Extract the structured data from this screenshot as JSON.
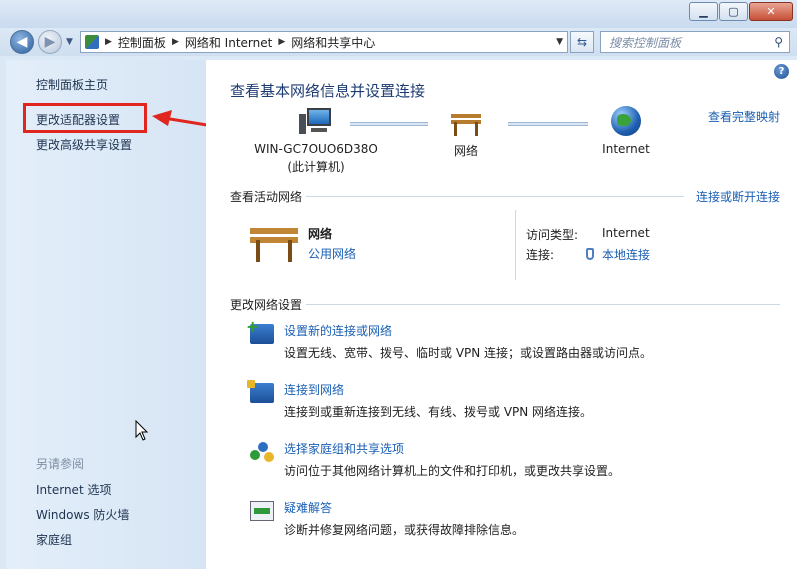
{
  "window": {
    "minimize_glyph": "▁",
    "maximize_glyph": "▢",
    "close_glyph": "✕"
  },
  "nav": {
    "back_glyph": "◀",
    "forward_glyph": "▶",
    "breadcrumb": [
      "控制面板",
      "网络和 Internet",
      "网络和共享中心"
    ],
    "breadcrumb_separator": "▶",
    "search_placeholder": "搜索控制面板",
    "search_icon": "magnifier-icon",
    "refresh_icon": "refresh-icon"
  },
  "sidebar": {
    "items": [
      {
        "label": "控制面板主页"
      },
      {
        "label": "更改适配器设置"
      },
      {
        "label": "更改高级共享设置"
      }
    ],
    "see_also_label": "另请参阅",
    "see_also": [
      {
        "label": "Internet 选项"
      },
      {
        "label": "Windows 防火墙"
      },
      {
        "label": "家庭组"
      }
    ]
  },
  "main": {
    "help_glyph": "?",
    "title": "查看基本网络信息并设置连接",
    "full_map_link": "查看完整映射",
    "map": {
      "computer_name": "WIN-GC7OUO6D38O",
      "computer_note": "(此计算机)",
      "network_label": "网络",
      "internet_label": "Internet"
    },
    "active": {
      "section_label": "查看活动网络",
      "connect_disconnect_link": "连接或断开连接",
      "network_name": "网络",
      "network_type": "公用网络",
      "access_type_key": "访问类型:",
      "access_type_value": "Internet",
      "connection_key": "连接:",
      "connection_value": "本地连接"
    },
    "change": {
      "section_label": "更改网络设置",
      "tasks": [
        {
          "title": "设置新的连接或网络",
          "desc": "设置无线、宽带、拨号、临时或 VPN 连接；或设置路由器或访问点。",
          "icon": "new-connection-icon"
        },
        {
          "title": "连接到网络",
          "desc": "连接到或重新连接到无线、有线、拨号或 VPN 网络连接。",
          "icon": "connect-network-icon"
        },
        {
          "title": "选择家庭组和共享选项",
          "desc": "访问位于其他网络计算机上的文件和打印机，或更改共享设置。",
          "icon": "homegroup-icon"
        },
        {
          "title": "疑难解答",
          "desc": "诊断并修复网络问题，或获得故障排除信息。",
          "icon": "troubleshoot-icon"
        }
      ]
    }
  },
  "colors": {
    "link": "#1a5fb4",
    "title": "#1e3c73",
    "highlight_box": "#e0261f",
    "sidebar_bg": "#dbe8f5"
  }
}
